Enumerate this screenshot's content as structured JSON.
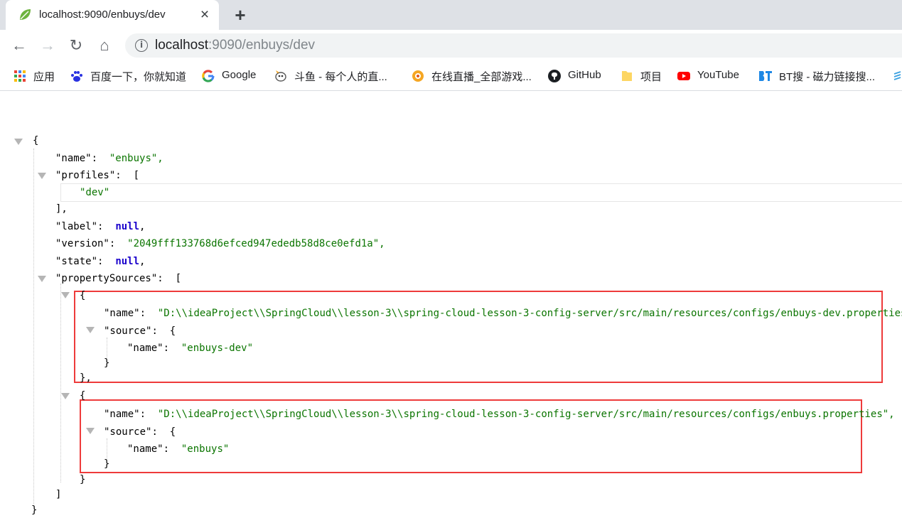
{
  "browser": {
    "tab": {
      "title": "localhost:9090/enbuys/dev",
      "close_icon": "×"
    },
    "new_tab_icon": "+",
    "nav": {
      "back": "←",
      "forward": "→",
      "reload": "↻",
      "home": "⌂"
    },
    "address": {
      "info_icon": "i",
      "host": "localhost",
      "path": ":9090/enbuys/dev"
    }
  },
  "bookmarks": [
    {
      "label": "应用",
      "icon": "apps-grid-icon"
    },
    {
      "label": "百度一下，你就知道",
      "icon": "baidu-paw-icon"
    },
    {
      "label": "Google",
      "icon": "google-g-icon"
    },
    {
      "label": "斗鱼 - 每个人的直...",
      "icon": "douyu-icon"
    },
    {
      "label": "在线直播_全部游戏...",
      "icon": "huya-icon"
    },
    {
      "label": "GitHub",
      "icon": "github-icon"
    },
    {
      "label": "项目",
      "icon": "folder-icon"
    },
    {
      "label": "YouTube",
      "icon": "youtube-icon"
    },
    {
      "label": "BT搜 - 磁力链接搜...",
      "icon": "bt-icon"
    }
  ],
  "json": {
    "open_brace": "{",
    "close_brace": "}",
    "open_bracket": "[",
    "close_bracket": "]",
    "close_bracket_comma": "],",
    "close_brace_comma": "},",
    "name_key": "\"name\"",
    "name_value": "\"enbuys\",",
    "profiles_key": "\"profiles\"",
    "profile_0": "\"dev\"",
    "label_key": "\"label\"",
    "label_value": "null",
    "version_key": "\"version\"",
    "version_value": "\"2049fff133768d6efced947ededb58d8ce0efd1a\",",
    "state_key": "\"state\"",
    "state_value": "null",
    "property_sources_key": "\"propertySources\"",
    "sources": [
      {
        "name_value": "\"D:\\\\ideaProject\\\\SpringCloud\\\\lesson-3\\\\spring-cloud-lesson-3-config-server/src/main/resources/configs/enbuys-dev.properties\",",
        "source_name_value": "\"enbuys-dev\""
      },
      {
        "name_value": "\"D:\\\\ideaProject\\\\SpringCloud\\\\lesson-3\\\\spring-cloud-lesson-3-config-server/src/main/resources/configs/enbuys.properties\",",
        "source_name_value": "\"enbuys\""
      }
    ],
    "source_key": "\"source\"",
    "colon": ":",
    "comma": ","
  },
  "highlight_color": "#ee3b3b"
}
